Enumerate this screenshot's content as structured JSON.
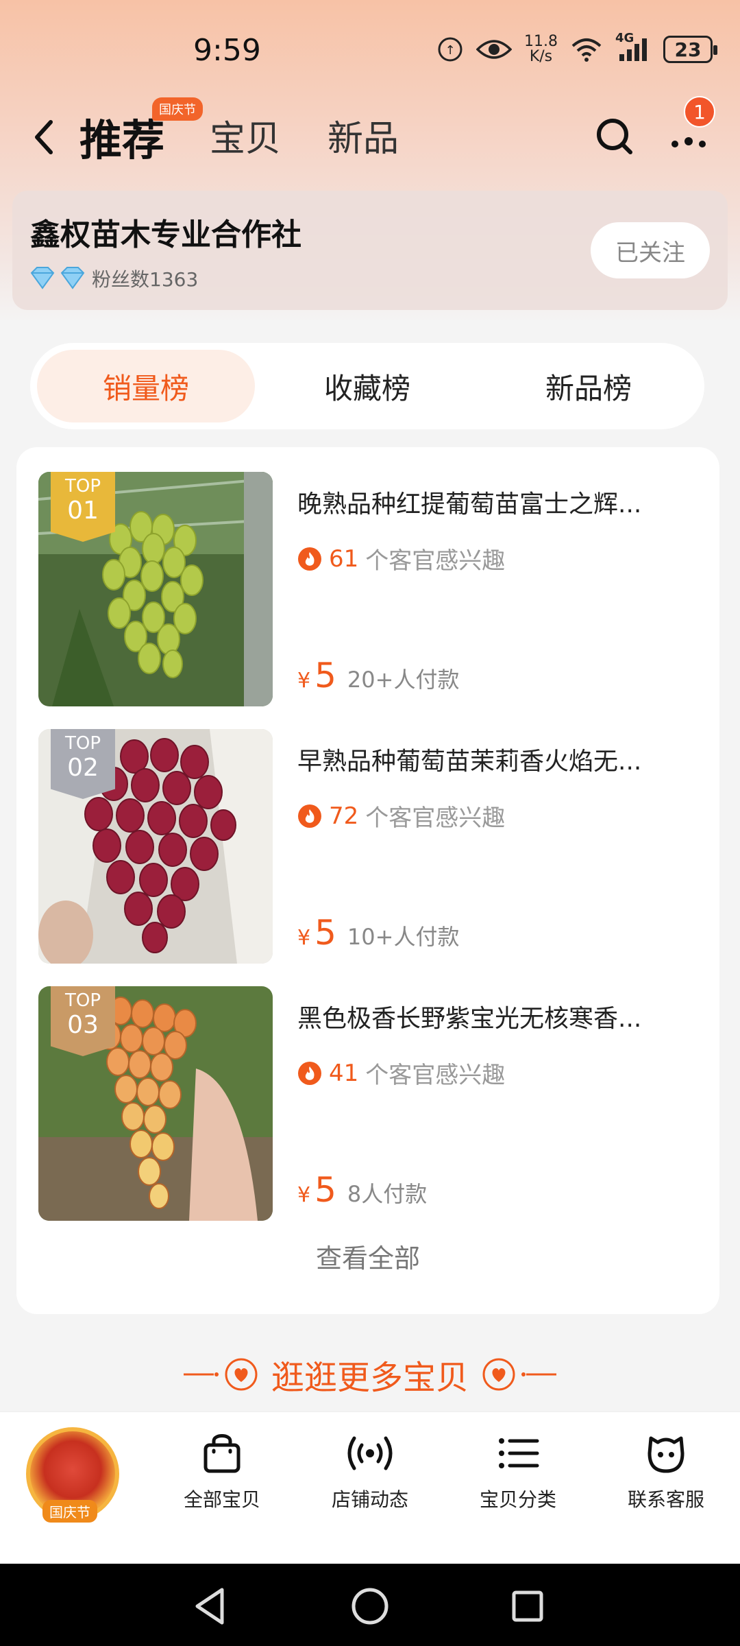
{
  "status_bar": {
    "time": "9:59",
    "speed_top": "11.8",
    "speed_bottom": "K/s",
    "network": "4G",
    "battery": "23"
  },
  "nav": {
    "tabs": [
      "推荐",
      "宝贝",
      "新品"
    ],
    "active_tab": "推荐",
    "festival_badge": "国庆节",
    "more_badge_count": "1"
  },
  "shop": {
    "name": "鑫权苗木专业合作社",
    "fans_label": "粉丝数1363",
    "follow_label": "已关注"
  },
  "ranking_tabs": [
    "销量榜",
    "收藏榜",
    "新品榜"
  ],
  "ranking_active": "销量榜",
  "items": [
    {
      "rank_top": "TOP",
      "rank_num": "01",
      "title": "晚熟品种红提葡萄苗富士之辉...",
      "interest_count": "61",
      "interest_suffix": "个客官感兴趣",
      "yen": "¥",
      "price": "5",
      "paid": "20+人付款",
      "badge_color": "#e8b83a"
    },
    {
      "rank_top": "TOP",
      "rank_num": "02",
      "title": "早熟品种葡萄苗茉莉香火焰无...",
      "interest_count": "72",
      "interest_suffix": "个客官感兴趣",
      "yen": "¥",
      "price": "5",
      "paid": "10+人付款",
      "badge_color": "#a9abb3"
    },
    {
      "rank_top": "TOP",
      "rank_num": "03",
      "title": "黑色极香长野紫宝光无核寒香...",
      "interest_count": "41",
      "interest_suffix": "个客官感兴趣",
      "yen": "¥",
      "price": "5",
      "paid": "8人付款",
      "badge_color": "#c99a66"
    }
  ],
  "view_all": "查看全部",
  "more_banner": "逛逛更多宝贝",
  "tab_bar": {
    "logo_label": "国庆节",
    "items": [
      "全部宝贝",
      "店铺动态",
      "宝贝分类",
      "联系客服"
    ]
  },
  "colors": {
    "accent": "#f05a1c",
    "top_gradient": "#f7c2a6"
  }
}
